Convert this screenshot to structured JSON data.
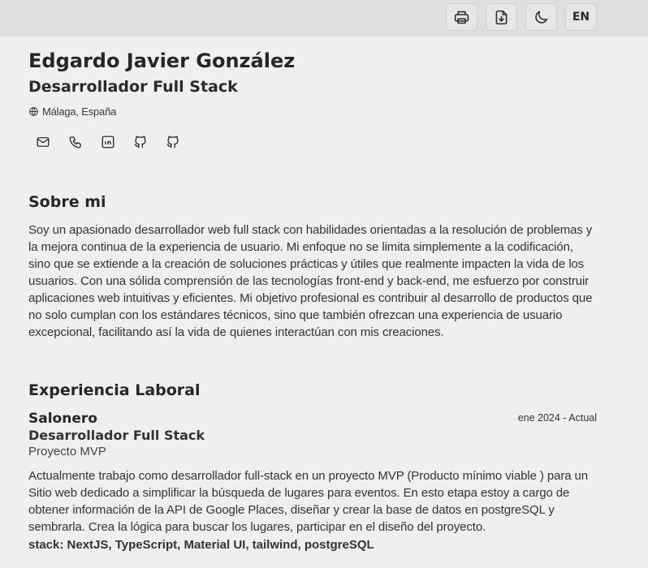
{
  "toolbar": {
    "buttons": [
      {
        "icon": "printer-icon",
        "label": ""
      },
      {
        "icon": "download-file-icon",
        "label": ""
      },
      {
        "icon": "moon-icon",
        "label": ""
      }
    ],
    "language_label": "EN"
  },
  "header": {
    "name": "Edgardo Javier González",
    "title": "Desarrollador Full Stack",
    "location": "Málaga, España",
    "contacts": [
      {
        "icon": "mail-icon"
      },
      {
        "icon": "phone-icon"
      },
      {
        "icon": "linkedin-icon"
      },
      {
        "icon": "github-icon"
      },
      {
        "icon": "github-icon"
      }
    ]
  },
  "about": {
    "title": "Sobre mi",
    "text": "Soy un apasionado desarrollador web full stack con habilidades orientadas a la resolución de problemas y la mejora continua de la experiencia de usuario. Mi enfoque no se limita simplemente a la codificación, sino que se extiende a la creación de soluciones prácticas y útiles que realmente impacten la vida de los usuarios. Con una sólida comprensión de las tecnologías front-end y back-end, me esfuerzo por construir aplicaciones web intuitivas y eficientes. Mi objetivo profesional es contribuir al desarrollo de productos que no solo cumplan con los estándares técnicos, sino que también ofrezcan una experiencia de usuario excepcional, facilitando así la vida de quienes interactúan con mis creaciones."
  },
  "experience": {
    "title": "Experiencia Laboral",
    "jobs": [
      {
        "company": "Salonero",
        "period": "ene 2024 - Actual",
        "position": "Desarrollador Full Stack",
        "project": "Proyecto MVP",
        "description": "Actualmente trabajo como desarrollador full-stack en un proyecto MVP (Producto mínimo viable ) para un Sitio web dedicado a simplificar la búsqueda de lugares para eventos. En esto etapa estoy a cargo de obtener información de la API de Google Places, diseñar y crear la base de datos en postgreSQL y sembrarla. Crea la lógica para buscar los lugares, participar en el diseño del proyecto.",
        "stack": "stack: NextJS, TypeScript, Material UI, tailwind, postgreSQL"
      }
    ]
  }
}
